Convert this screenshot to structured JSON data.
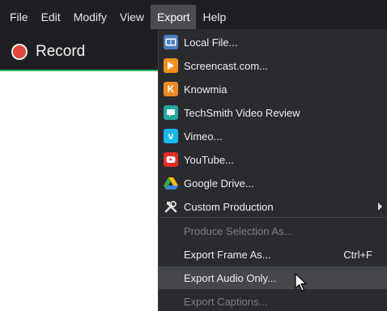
{
  "menubar": {
    "items": [
      {
        "label": "File"
      },
      {
        "label": "Edit"
      },
      {
        "label": "Modify"
      },
      {
        "label": "View"
      },
      {
        "label": "Export"
      },
      {
        "label": "Help"
      }
    ],
    "active": "Export"
  },
  "toolbar": {
    "record_label": "Record",
    "record_color": "#e2453a"
  },
  "export_menu": {
    "items": [
      {
        "label": "Local File...",
        "icon": "local-file-icon",
        "color": "#4a7fc0"
      },
      {
        "label": "Screencast.com...",
        "icon": "screencast-icon",
        "color": "#f0901e"
      },
      {
        "label": "Knowmia",
        "icon": "knowmia-icon",
        "color": "#f08a24"
      },
      {
        "label": "TechSmith Video Review",
        "icon": "video-review-icon",
        "color": "#23a6a0"
      },
      {
        "label": "Vimeo...",
        "icon": "vimeo-icon",
        "color": "#1ab7ea"
      },
      {
        "label": "YouTube...",
        "icon": "youtube-icon",
        "color": "#e52d27"
      },
      {
        "label": "Google Drive...",
        "icon": "google-drive-icon",
        "color": "#34a853"
      },
      {
        "label": "Custom Production",
        "icon": "tools-icon",
        "color": "#cfcfcf"
      },
      {
        "label": "Produce Selection As...",
        "disabled": true
      },
      {
        "label": "Export Frame As...",
        "shortcut": "Ctrl+F"
      },
      {
        "label": "Export Audio Only...",
        "hover": true
      },
      {
        "label": "Export Captions...",
        "disabled": true
      }
    ]
  }
}
